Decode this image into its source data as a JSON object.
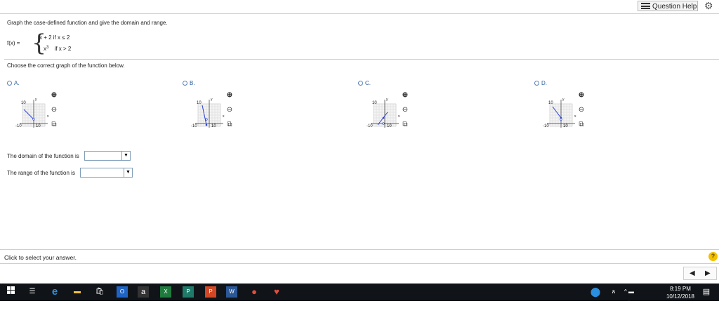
{
  "header": {
    "question_help": "Question Help",
    "settings_icon": "gear-icon"
  },
  "question": {
    "prompt": "Graph the case-defined function and give the domain and range.",
    "fx": "f(x) =",
    "piece1": "x + 2  if  x ≤ 2",
    "piece2_base": "x",
    "piece2_exp": "3",
    "piece2_cond": "if  x > 2",
    "choose": "Choose the correct graph of the function below."
  },
  "options": [
    {
      "label": "A.",
      "ytick": "10",
      "xleft": "-10",
      "xright": "10",
      "xaxis": "x",
      "yaxis": "y"
    },
    {
      "label": "B.",
      "ytick": "10",
      "xleft": "-10",
      "xright": "10",
      "xaxis": "x",
      "yaxis": "y"
    },
    {
      "label": "C.",
      "ytick": "10",
      "xleft": "-10",
      "xright": "10",
      "xaxis": "x",
      "yaxis": "y"
    },
    {
      "label": "D.",
      "ytick": "10",
      "xleft": "-10",
      "xright": "10",
      "xaxis": "x",
      "yaxis": "y"
    }
  ],
  "answers": {
    "domain_label": "The domain of the function is",
    "range_label": "The range of the function is",
    "domain_value": "",
    "range_value": ""
  },
  "footer": {
    "status": "Click to select your answer."
  },
  "taskbar": {
    "time": "8:19 PM",
    "date": "10/12/2018"
  }
}
